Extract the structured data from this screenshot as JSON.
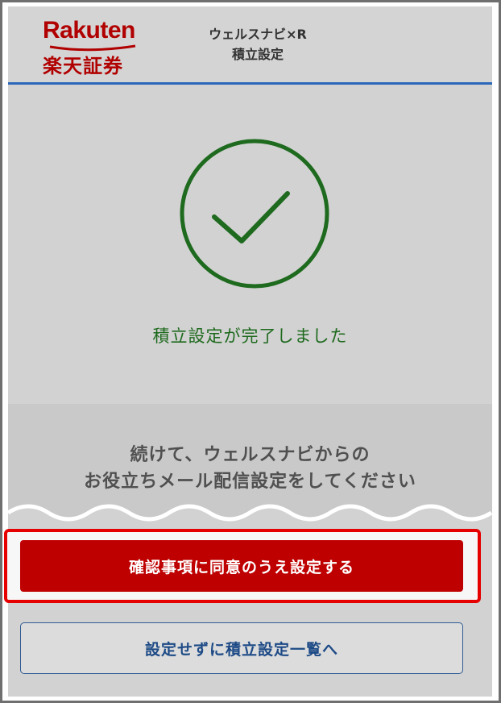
{
  "header": {
    "logo_text": "Rakuten",
    "logo_ja": "楽天証券",
    "title_line1": "ウェルスナビ×R",
    "title_line2": "積立設定"
  },
  "success": {
    "message": "積立設定が完了しました",
    "icon": "check-circle-icon",
    "color": "#1e6a1e"
  },
  "promo": {
    "line1": "続けて、ウェルスナビからの",
    "line2": "お役立ちメール配信設定をしてください"
  },
  "actions": {
    "confirm_label": "確認事項に同意のうえ設定する",
    "skip_label": "設定せずに積立設定一覧へ"
  },
  "colors": {
    "brand_red": "#bf0000",
    "highlight_red": "#e60000",
    "header_rule_blue": "#2a67b8",
    "link_blue": "#1d4a86"
  }
}
